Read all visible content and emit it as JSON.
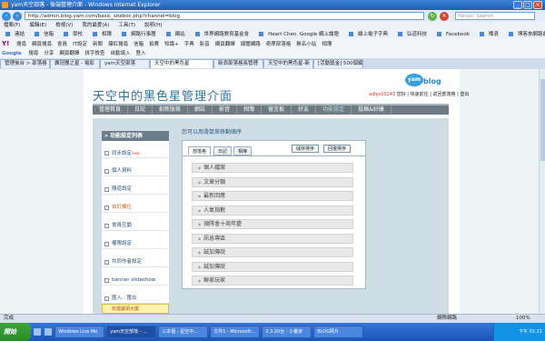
{
  "window": {
    "title": "yam天空部落 - 後端管理介面 - Windows Internet Explorer"
  },
  "address": {
    "url": "http://admin.blog.yam.com/basic_siteboc.php?channel=blog",
    "search_placeholder": "Yahoo! Search"
  },
  "menubar": [
    "檔案(F)",
    "編輯(E)",
    "檢視(V)",
    "我的最愛(A)",
    "工具(T)",
    "說明(H)"
  ],
  "favorites": [
    "連結",
    "信箱",
    "學校",
    "相簿",
    "網路行事曆",
    "網站",
    "世界網路教育基金會",
    "Heart Chen. Google 網上論壇",
    "線上電子字典",
    "弘道科技",
    "Facebook",
    "噗浪",
    "博客來網路書店",
    "StickerAction",
    "Windows",
    "Windows Media"
  ],
  "yahoo_bar": {
    "logo": "Y!",
    "items": [
      "搜尋",
      "網頁搜尋",
      "會員",
      "IT設定",
      "新聞",
      "爆紅搜尋",
      "信箱",
      "拍賣",
      "知識+",
      "字典",
      "影音",
      "網頁翻譯",
      "媒體網路",
      "奇摩部落格",
      "無名小站",
      "相簿"
    ]
  },
  "google_bar": {
    "logo": "Google",
    "items": [
      "搜尋",
      "分享",
      "網頁翻譯",
      "拼字檢查",
      "自動填入",
      "登入"
    ]
  },
  "tabs": [
    {
      "label": "管理後台 > 部落格",
      "active": false
    },
    {
      "label": "廣冠團之星 - 電影",
      "active": false
    },
    {
      "label": "yam天空部落",
      "active": false
    },
    {
      "label": "天空中的黑色星",
      "active": true
    },
    {
      "label": "新浪部落格長管理",
      "active": false
    },
    {
      "label": "天空中的黑色星-新",
      "active": false
    },
    {
      "label": "[活動獎金] 500個編",
      "active": false
    }
  ],
  "site": {
    "title": "天空中的黑色星管理介面",
    "logo_bubble": "yam",
    "logo_text": "blog",
    "username": "adlys10243",
    "greeting": "您好",
    "link_home": "快速前往",
    "link_blog": "返回部落格",
    "link_logout": "登出"
  },
  "nav": [
    "管理首頁",
    "日記",
    "創新版條",
    "網誌",
    "影音",
    "相簿",
    "留言板",
    "好友",
    "功能設定",
    "投稿&好康"
  ],
  "sidebar": {
    "title": "» 功能設定列表",
    "items": [
      {
        "label": "同步設定",
        "tag": "new",
        "active": false
      },
      {
        "label": "個人資料",
        "active": false
      },
      {
        "label": "隱道設定",
        "active": false
      },
      {
        "label": "自訂欄位",
        "active": true
      },
      {
        "label": "會員互動",
        "active": false
      },
      {
        "label": "權限設定",
        "active": false
      },
      {
        "label": "共同作者設定",
        "active": false
      },
      {
        "label": "banner slideshow",
        "active": false
      },
      {
        "label": "匯入／匯出",
        "active": false
      }
    ],
    "promo": "玩遊戲領大獎"
  },
  "panel": {
    "hint": "您可以用滑鼠來移動順序",
    "tabs": [
      "部落格",
      "日記",
      "相簿"
    ],
    "save_label": "儲存排序",
    "reset_label": "回復排序",
    "items": [
      "個人檔案",
      "文章分類",
      "最新回應",
      "人氣指數",
      "領隊會十周年慶",
      "訊息專區",
      "誠加傳說",
      "誠加傳說",
      "聯家玩家"
    ]
  },
  "status": {
    "text": "完成",
    "zone": "網際網路",
    "zoom": "100%"
  },
  "taskbar": {
    "start": "開始",
    "tasks": [
      "Windows Live Me",
      "yam天空部落 - ...",
      "三本個 - 星空中...",
      "文件1 - Microsoft...",
      "3.3.20台 - 小畫家",
      "BLOG照片"
    ],
    "active_index": 1,
    "clock": "下午 01:21"
  }
}
